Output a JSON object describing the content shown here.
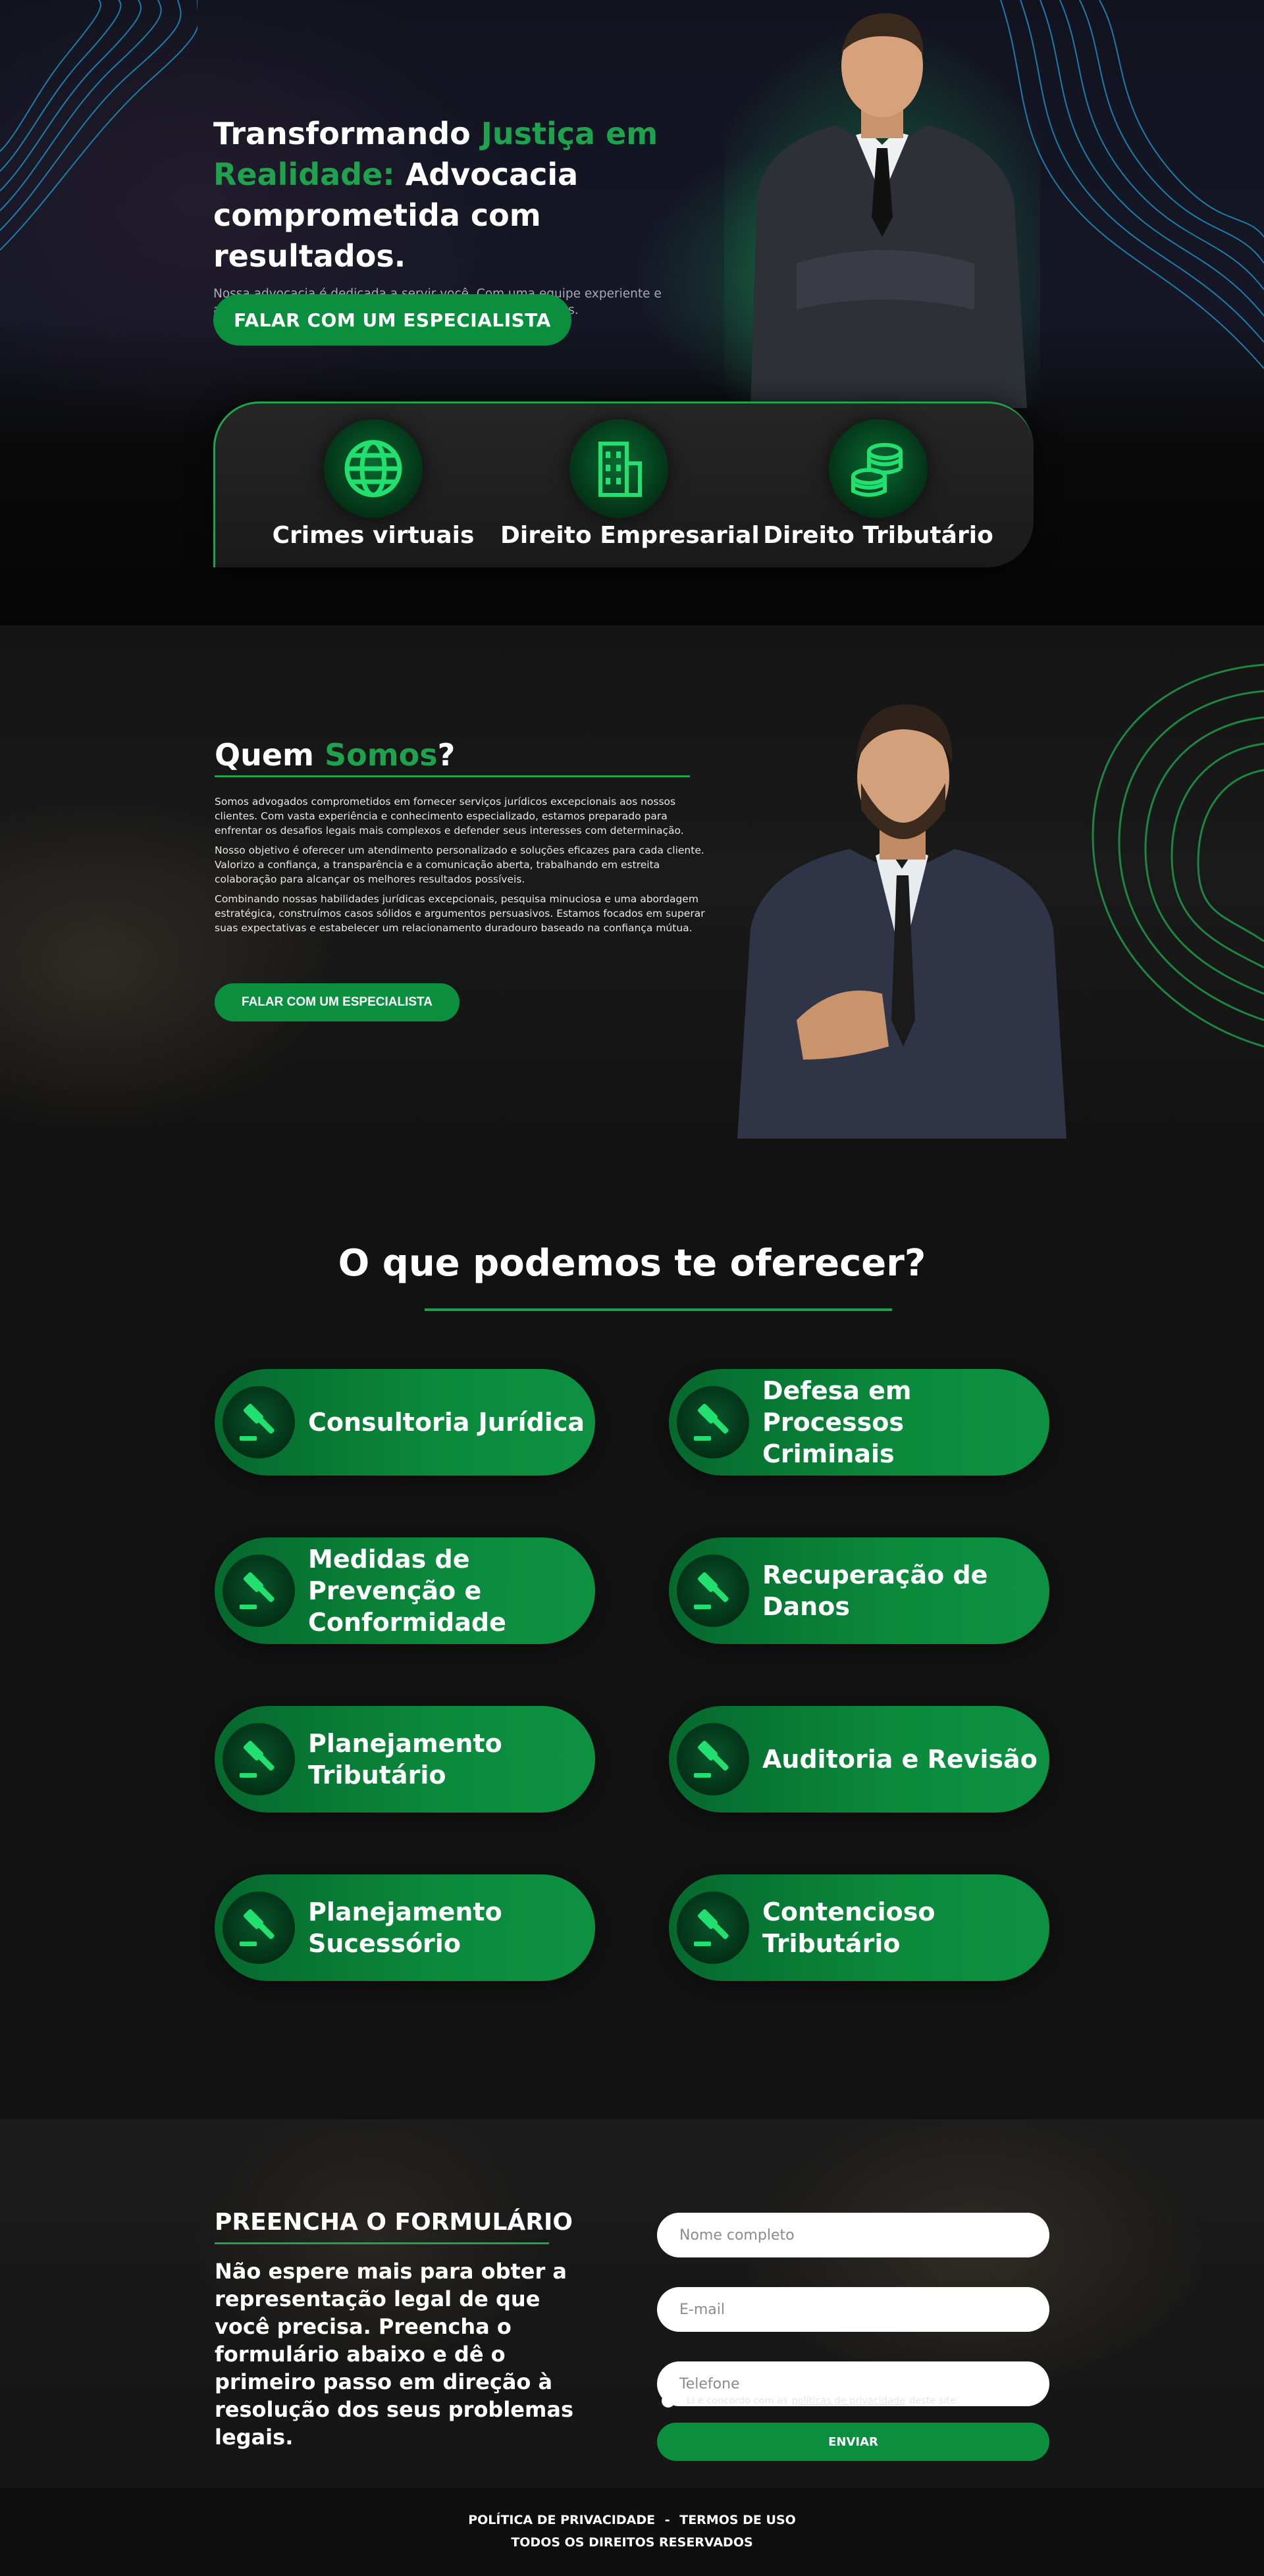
{
  "hero": {
    "title_part1": "Transformando ",
    "title_accent": "Justiça em Realidade:",
    "title_part2": " Advocacia comprometida com resultados.",
    "subtitle": "Nossa advocacia é dedicada a servir você. Com uma equipe experiente e apaixonada, estamos prontos para lutar pelos seus direitos.",
    "cta_label": "FALAR COM UM ESPECIALISTA"
  },
  "areas": [
    {
      "label": "Crimes virtuais",
      "icon": "globe-icon"
    },
    {
      "label": "Direito Empresarial",
      "icon": "building-icon"
    },
    {
      "label": "Direito Tributário",
      "icon": "coins-icon"
    }
  ],
  "about": {
    "title_part1": "Quem ",
    "title_accent": "Somos",
    "title_part2": "?",
    "paragraphs": [
      "Somos advogados comprometidos em fornecer serviços jurídicos excepcionais aos nossos clientes. Com vasta experiência e conhecimento especializado, estamos preparado para enfrentar os desafios legais mais complexos e defender seus interesses com determinação.",
      "Nosso objetivo é oferecer um atendimento personalizado e soluções eficazes para cada cliente. Valorizo a confiança, a transparência e a comunicação aberta, trabalhando em estreita colaboração para alcançar os melhores resultados possíveis.",
      "Combinando nossas habilidades jurídicas excepcionais, pesquisa minuciosa e uma abordagem estratégica, construímos casos sólidos e argumentos persuasivos. Estamos focados em superar suas expectativas e estabelecer um relacionamento duradouro baseado na confiança mútua."
    ],
    "cta_label": "FALAR COM UM ESPECIALISTA"
  },
  "services": {
    "title": "O que podemos te oferecer?",
    "items": [
      {
        "label": "Consultoria Jurídica",
        "icon": "gavel-icon"
      },
      {
        "label": "Defesa em Processos Criminais",
        "icon": "gavel-icon"
      },
      {
        "label": "Medidas de Prevenção e Conformidade",
        "icon": "gavel-icon"
      },
      {
        "label": "Recuperação de Danos",
        "icon": "gavel-icon"
      },
      {
        "label": "Planejamento Tributário",
        "icon": "gavel-icon"
      },
      {
        "label": "Auditoria e Revisão",
        "icon": "gavel-icon"
      },
      {
        "label": "Planejamento Sucessório",
        "icon": "gavel-icon"
      },
      {
        "label": "Contencioso Tributário",
        "icon": "gavel-icon"
      }
    ]
  },
  "form": {
    "heading": "PREENCHA O FORMULÁRIO",
    "description": "Não espere mais para obter a representação legal de que você precisa. Preencha o formulário abaixo e dê o primeiro passo em direção à resolução dos seus problemas legais.",
    "name_placeholder": "Nome completo",
    "email_placeholder": "E-mail",
    "phone_placeholder": "Telefone",
    "consent_prefix": "Li e concordo com as",
    "consent_link": "políticas de privacidade",
    "consent_suffix": "deste site.",
    "submit_label": "ENVIAR"
  },
  "footer": {
    "privacy": "POLÍTICA DE PRIVACIDADE",
    "separator": "-",
    "terms": "TERMOS DE USO",
    "rights": "TODOS OS DIREITOS RESERVADOS"
  },
  "colors": {
    "accent": "#1fa24d",
    "button": "#0b8f3f",
    "background": "#121212"
  }
}
